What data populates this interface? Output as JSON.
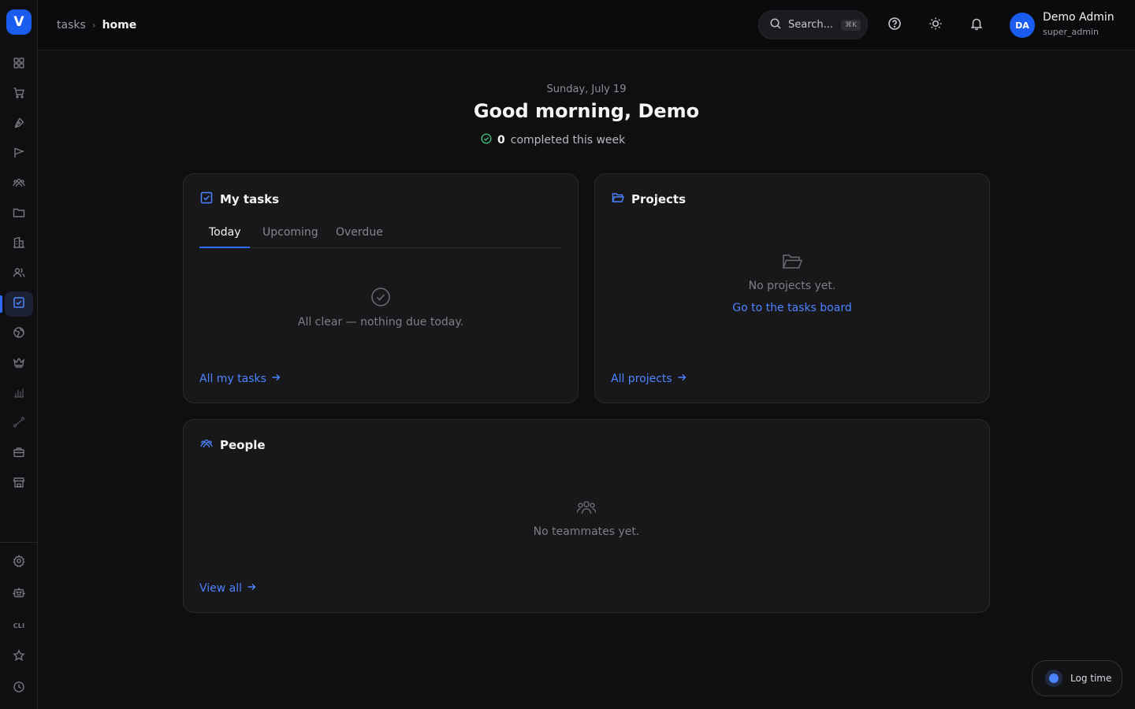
{
  "app": {
    "logo_letter": "V"
  },
  "sidebar": {
    "items": [
      {
        "icon": "grid-icon",
        "name": "sidebar-item-dashboard"
      },
      {
        "icon": "cart-icon",
        "name": "sidebar-item-shop"
      },
      {
        "icon": "pen-tool-icon",
        "name": "sidebar-item-design"
      },
      {
        "icon": "flag-icon",
        "name": "sidebar-item-campaigns"
      },
      {
        "icon": "users-group-icon",
        "name": "sidebar-item-community"
      },
      {
        "icon": "folder-icon",
        "name": "sidebar-item-files"
      },
      {
        "icon": "building-icon",
        "name": "sidebar-item-company"
      },
      {
        "icon": "users-icon",
        "name": "sidebar-item-people"
      },
      {
        "icon": "checkbox-icon",
        "name": "sidebar-item-tasks",
        "active": true
      },
      {
        "icon": "globe-icon",
        "name": "sidebar-item-web"
      },
      {
        "icon": "crown-icon",
        "name": "sidebar-item-premium"
      },
      {
        "icon": "bar-chart-icon",
        "name": "sidebar-item-analytics"
      },
      {
        "icon": "route-icon",
        "name": "sidebar-item-routes"
      },
      {
        "icon": "briefcase-icon",
        "name": "sidebar-item-jobs"
      },
      {
        "icon": "store-icon",
        "name": "sidebar-item-store"
      }
    ],
    "bottom_items": [
      {
        "icon": "gear-icon",
        "name": "sidebar-item-settings"
      },
      {
        "icon": "robot-icon",
        "name": "sidebar-item-bots"
      },
      {
        "label": "CLI",
        "name": "sidebar-item-cli"
      },
      {
        "icon": "star-icon",
        "name": "sidebar-item-favorites"
      },
      {
        "icon": "clock-icon",
        "name": "sidebar-item-history"
      }
    ]
  },
  "header": {
    "breadcrumb": {
      "parent": "tasks",
      "current": "home"
    },
    "search": {
      "placeholder": "Search...",
      "shortcut": "⌘K"
    },
    "user": {
      "initials": "DA",
      "name": "Demo Admin",
      "role": "super_admin"
    }
  },
  "greeting": {
    "date": "Sunday, July 19",
    "title": "Good morning, Demo",
    "completed_count": "0",
    "completed_label": "completed this week"
  },
  "my_tasks": {
    "title": "My tasks",
    "tabs": [
      "Today",
      "Upcoming",
      "Overdue"
    ],
    "active_tab": "Today",
    "empty_text": "All clear — nothing due today.",
    "link": "All my tasks"
  },
  "projects": {
    "title": "Projects",
    "empty_text": "No projects yet.",
    "board_link": "Go to the tasks board",
    "link": "All projects"
  },
  "people": {
    "title": "People",
    "empty_text": "No teammates yet.",
    "link": "View all"
  },
  "log_time": {
    "label": "Log time"
  },
  "colors": {
    "accent": "#2f6bff",
    "brand": "#1b5cf0",
    "success": "#3fb876",
    "background": "#0f0f11",
    "card": "#18181b"
  }
}
